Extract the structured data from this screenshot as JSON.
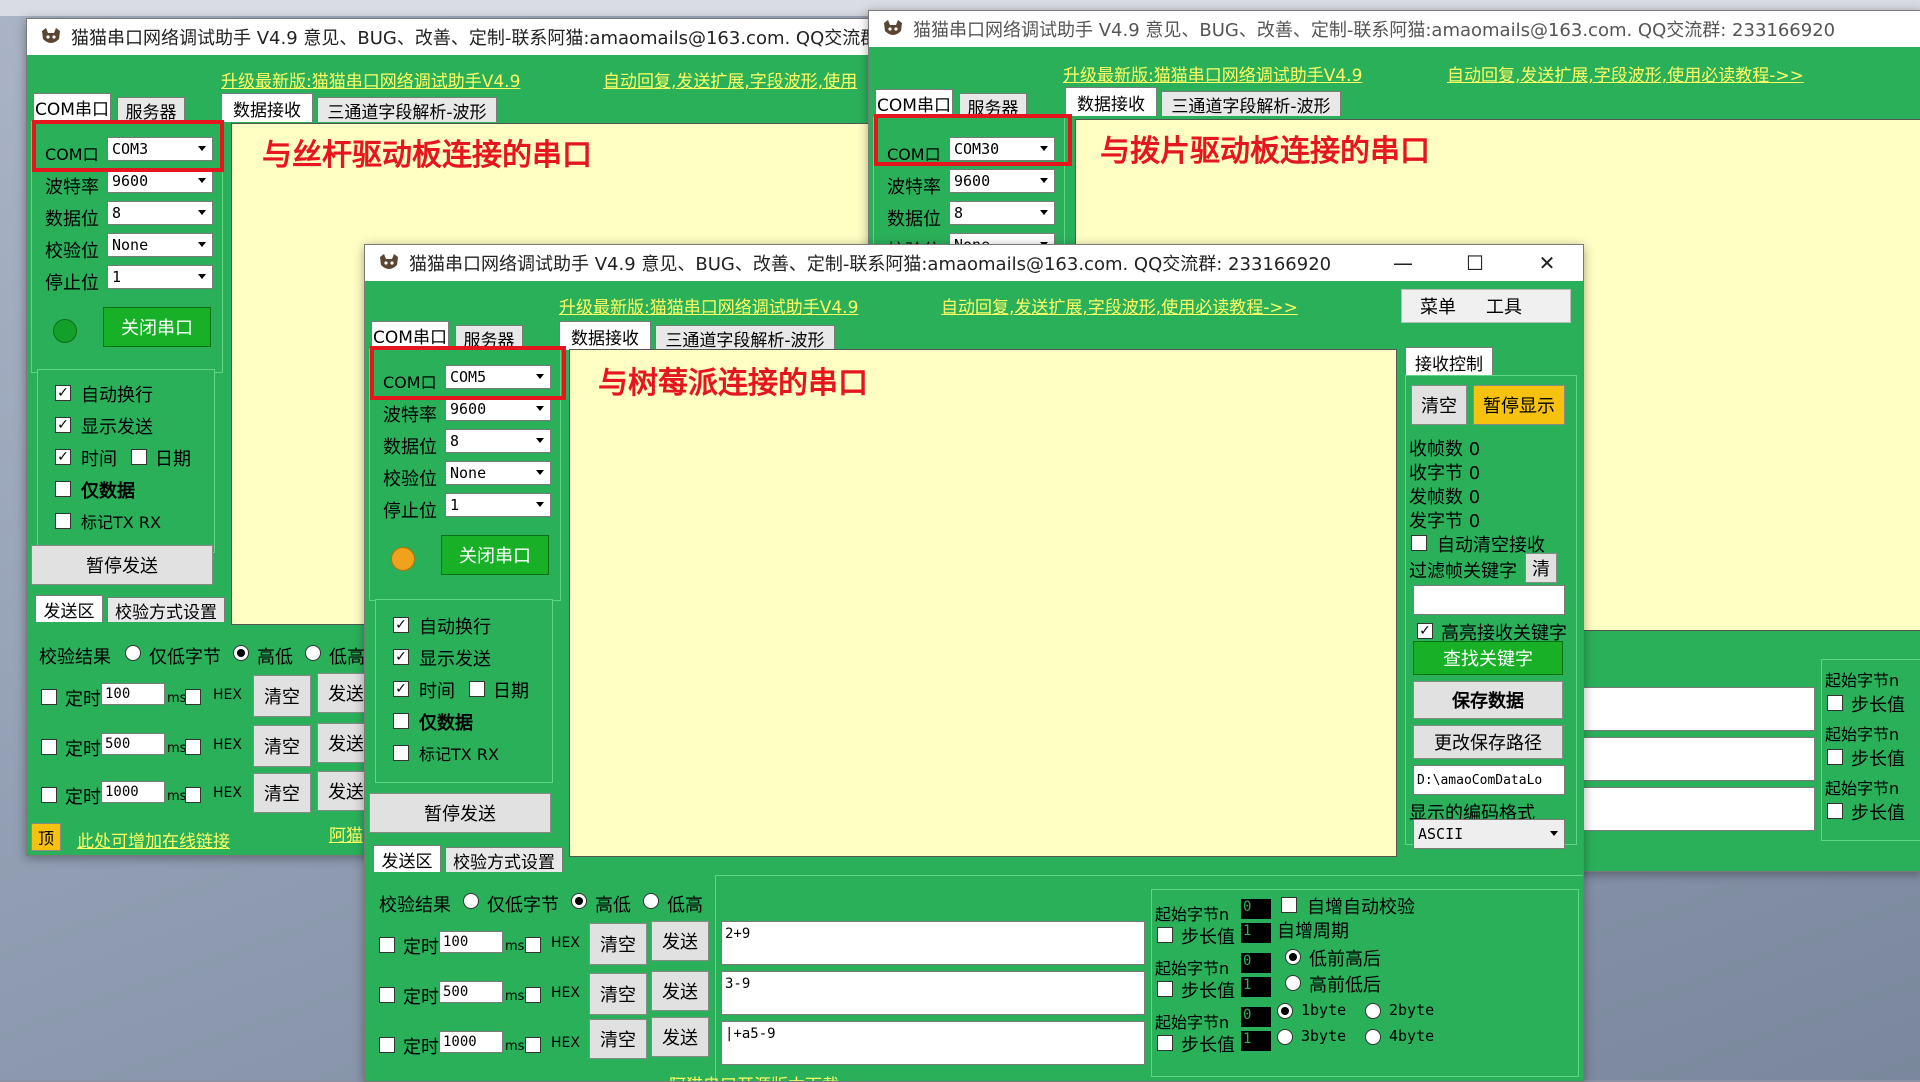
{
  "app": {
    "title": "猫猫串口网络调试助手 V4.9 意见、BUG、改善、定制-联系阿猫:amaomails@163.com. QQ交流群: 233166920",
    "title_left_win": "猫猫串口网络调试助手 V4.9 意见、BUG、改善、定制-联系阿猫:amaomails@163.com. QQ交流群: ",
    "link_update": "升级最新版:猫猫串口网络调试助手V4.9",
    "link_update_short": "升级最新版:猫猫串口网络调试助手V4.9",
    "link_tutorial": "自动回复,发送扩展,字段波形,使用必读教程->>",
    "link_tutorial_left": "自动回复,发送扩展,字段波形,使用"
  },
  "tabs": {
    "com_serial": "COM串口",
    "server": "服务器",
    "data_receive": "数据接收",
    "three_channel": "三通道字段解析-波形",
    "send_area": "发送区",
    "checksum_settings": "校验方式设置",
    "receive_control": "接收控制"
  },
  "serial": {
    "port_label": "COM口",
    "baud_label": "波特率",
    "databits_label": "数据位",
    "parity_label": "校验位",
    "stopbits_label": "停止位",
    "close_port": "关闭串口"
  },
  "windows": {
    "left": {
      "port": "COM3",
      "baud": "9600",
      "databits": "8",
      "parity": "None",
      "stopbits": "1",
      "led_color": "#12a02a"
    },
    "right": {
      "port": "COM30",
      "baud": "9600",
      "databits": "8",
      "parity": "None"
    },
    "main": {
      "port": "COM5",
      "baud": "9600",
      "databits": "8",
      "parity": "None",
      "stopbits": "1",
      "led_color": "#f0a21c"
    }
  },
  "options": {
    "auto_newline": "自动换行",
    "show_send": "显示发送",
    "time": "时间",
    "date": "日期",
    "data_only": "仅数据",
    "mark_txrx": "标记TX RX",
    "pause_send": "暂停发送"
  },
  "send": {
    "checksum_result": "校验结果",
    "only_low_byte": "仅低字节",
    "high_low": "高低",
    "low_high": "低高",
    "timer": "定时",
    "ms": "ms",
    "hex": "HEX",
    "clear": "清空",
    "send": "发送",
    "rows_main": [
      {
        "interval": "100",
        "content": "2+9"
      },
      {
        "interval": "500",
        "content": "3-9"
      },
      {
        "interval": "1000",
        "content": "|+a5-9"
      }
    ],
    "rows_left": [
      "100",
      "500",
      "1000"
    ]
  },
  "receive_control": {
    "menu": "菜单",
    "tools": "工具",
    "clear": "清空",
    "pause_display": "暂停显示",
    "rx_frames": "收帧数 0",
    "rx_bytes": "收字节 0",
    "tx_frames": "发帧数 0",
    "tx_bytes": "发字节 0",
    "auto_clear": "自动清空接收",
    "filter_keyword": "过滤帧关键字",
    "filter_clear": "清",
    "highlight_keyword": "高亮接收关键字",
    "find_keyword": "查找关键字",
    "save_data": "保存数据",
    "change_save_path": "更改保存路径",
    "save_path": "D:\\amaoComDataLo",
    "display_encoding": "显示的编码格式",
    "encoding": "ASCII"
  },
  "ext": {
    "start_byte": "起始字节n",
    "step": "步长值",
    "start_val": "0",
    "step_val": "1",
    "auto_inc_checksum": "自增自动校验",
    "auto_inc_cycle": "自增周期",
    "low_first": "低前高后",
    "high_first": "高前低后",
    "b1": "1byte",
    "b2": "2byte",
    "b3": "3byte",
    "b4": "4byte"
  },
  "footer": {
    "pin": "顶",
    "add_link": "此处可增加在线链接",
    "amao": "阿猫",
    "opensource": "阿猫串口开源版本下载"
  },
  "annotations": {
    "screw_driver": "与丝杆驱动板连接的串口",
    "paddle_driver": "与拨片驱动板连接的串口",
    "raspberry_pi": "与树莓派连接的串口"
  },
  "colors": {
    "window_green": "#2bb05a",
    "receive_bg": "#ffffc4",
    "link_yellow": "#ffff66",
    "annotation_red": "#e5161d"
  }
}
